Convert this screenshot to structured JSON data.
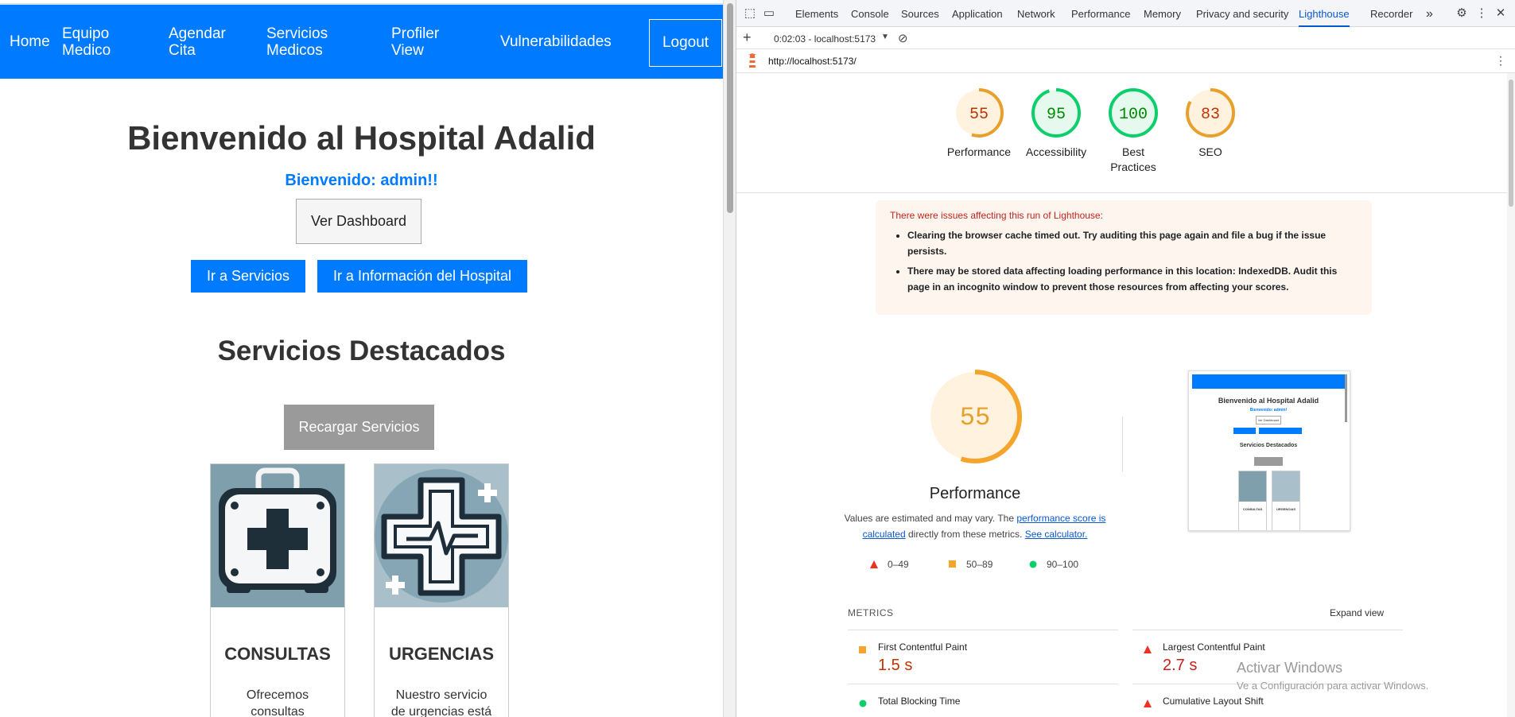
{
  "site": {
    "nav": [
      "Home",
      "Equipo\nMedico",
      "Agendar\nCita",
      "Servicios\nMedicos",
      "Profiler\nView",
      "Vulnerabilidades"
    ],
    "logout": "Logout",
    "welcome_title": "Bienvenido al Hospital Adalid",
    "welcome_user": "Bienvenido: admin!!",
    "dashboard_button": "Ver Dashboard",
    "services_button": "Ir a Servicios",
    "hospital_info_button": "Ir a Información del Hospital",
    "featured_title": "Servicios Destacados",
    "reload_button": "Recargar Servicios",
    "cards": [
      {
        "title": "CONSULTAS",
        "text": "Ofrecemos\nconsultas"
      },
      {
        "title": "URGENCIAS",
        "text": "Nuestro servicio\nde urgencias está"
      }
    ]
  },
  "devtools": {
    "tabs": [
      "Elements",
      "Console",
      "Sources",
      "Application",
      "Network",
      "Performance",
      "Memory",
      "Privacy and security",
      "Lighthouse",
      "Recorder"
    ],
    "active_tab": "Lighthouse",
    "more_tabs": "»",
    "report_selector": "0:02:03 - localhost:5173",
    "url": "http://localhost:5173/",
    "scores": [
      {
        "label": "Performance",
        "value": 55,
        "color": "#e8a02c"
      },
      {
        "label": "Accessibility",
        "value": 95,
        "color": "#0cce6b"
      },
      {
        "label": "Best\nPractices",
        "value": 100,
        "color": "#0cce6b"
      },
      {
        "label": "SEO",
        "value": 83,
        "color": "#e8a02c"
      }
    ],
    "warning": {
      "title": "There were issues affecting this run of Lighthouse:",
      "items": [
        "Clearing the browser cache timed out. Try auditing this page again and file a bug if the issue persists.",
        "There may be stored data affecting loading performance in this location: IndexedDB. Audit this page in an incognito window to prevent those resources from affecting your scores."
      ]
    },
    "performance": {
      "score": 55,
      "title": "Performance",
      "desc_prefix": "Values are estimated and may vary. The ",
      "desc_link1": "performance score is calculated",
      "desc_middle": " directly from these metrics. ",
      "desc_link2": "See calculator."
    },
    "legend": [
      "0–49",
      "50–89",
      "90–100"
    ],
    "metrics_label": "METRICS",
    "expand_view": "Expand view",
    "metrics": [
      {
        "name": "First Contentful Paint",
        "value": "1.5 s",
        "status": "average"
      },
      {
        "name": "Largest Contentful Paint",
        "value": "2.7 s",
        "status": "fail"
      },
      {
        "name": "Total Blocking Time",
        "value": "",
        "status": "pass"
      },
      {
        "name": "Cumulative Layout Shift",
        "value": "",
        "status": "fail"
      }
    ],
    "thumbnail": {
      "title": "Bienvenido al Hospital Adalid",
      "user": "Bienvenido: admin!",
      "dash": "Ver Dashboard",
      "section": "Servicios Destacados",
      "card1": "CONSULTAS",
      "card2": "URGENCIAS"
    }
  },
  "os_watermark": {
    "title": "Activar Windows",
    "subtitle": "Ve a Configuración para activar Windows."
  }
}
